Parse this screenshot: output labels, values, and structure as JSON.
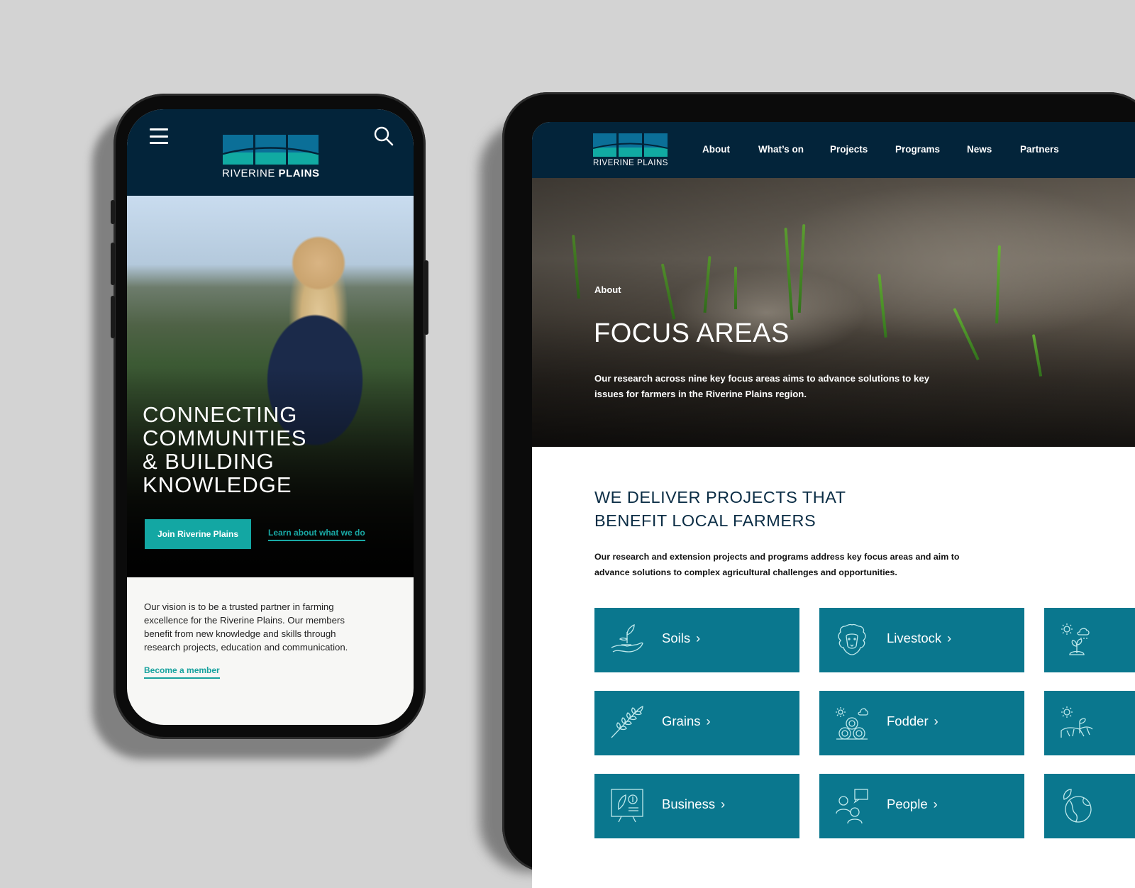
{
  "brand": {
    "name_light": "RIVERINE",
    "name_bold": "PLAINS",
    "colors": {
      "navy": "#03243a",
      "teal_button": "#13a7a3",
      "tile_teal": "#0a778e",
      "logo_blue": "#0b6f98",
      "logo_teal": "#11aaa2",
      "background": "#d3d3d3"
    }
  },
  "phone": {
    "header": {
      "menu_icon": "hamburger-menu-icon",
      "search_icon": "search-icon"
    },
    "hero": {
      "title_lines": [
        "CONNECTING",
        "COMMUNITIES",
        "& BUILDING",
        "KNOWLEDGE"
      ],
      "primary_button": "Join Riverine Plains",
      "secondary_link": "Learn about what we do"
    },
    "intro": {
      "text": "Our vision is to be a trusted partner in farming excellence for the Riverine Plains. Our members benefit from new knowledge and skills through research projects, education and communication.",
      "link": "Become a member"
    }
  },
  "tablet": {
    "nav": {
      "items": [
        "About",
        "What’s on",
        "Projects",
        "Programs",
        "News",
        "Partners"
      ]
    },
    "hero": {
      "breadcrumb": "About",
      "title": "FOCUS AREAS",
      "lead": "Our research across nine key focus areas aims to advance solutions to key issues for farmers in the Riverine Plains region."
    },
    "section": {
      "heading_lines": [
        "WE DELIVER PROJECTS THAT",
        "BENEFIT LOCAL FARMERS"
      ],
      "text": "Our research and extension projects and programs address key focus areas and aim to advance solutions to complex agricultural challenges and opportunities."
    },
    "focus_areas": [
      {
        "label": "Soils",
        "icon": "hand-seedling-icon"
      },
      {
        "label": "Livestock",
        "icon": "sheep-icon"
      },
      {
        "label": "",
        "icon": "weather-seedling-icon"
      },
      {
        "label": "Grains",
        "icon": "wheat-icon"
      },
      {
        "label": "Fodder",
        "icon": "hay-bales-icon"
      },
      {
        "label": "",
        "icon": "sun-plant-soil-icon"
      },
      {
        "label": "Business",
        "icon": "presentation-board-icon"
      },
      {
        "label": "People",
        "icon": "people-chat-icon"
      },
      {
        "label": "",
        "icon": "globe-leaf-icon"
      }
    ],
    "chevron": "›"
  }
}
